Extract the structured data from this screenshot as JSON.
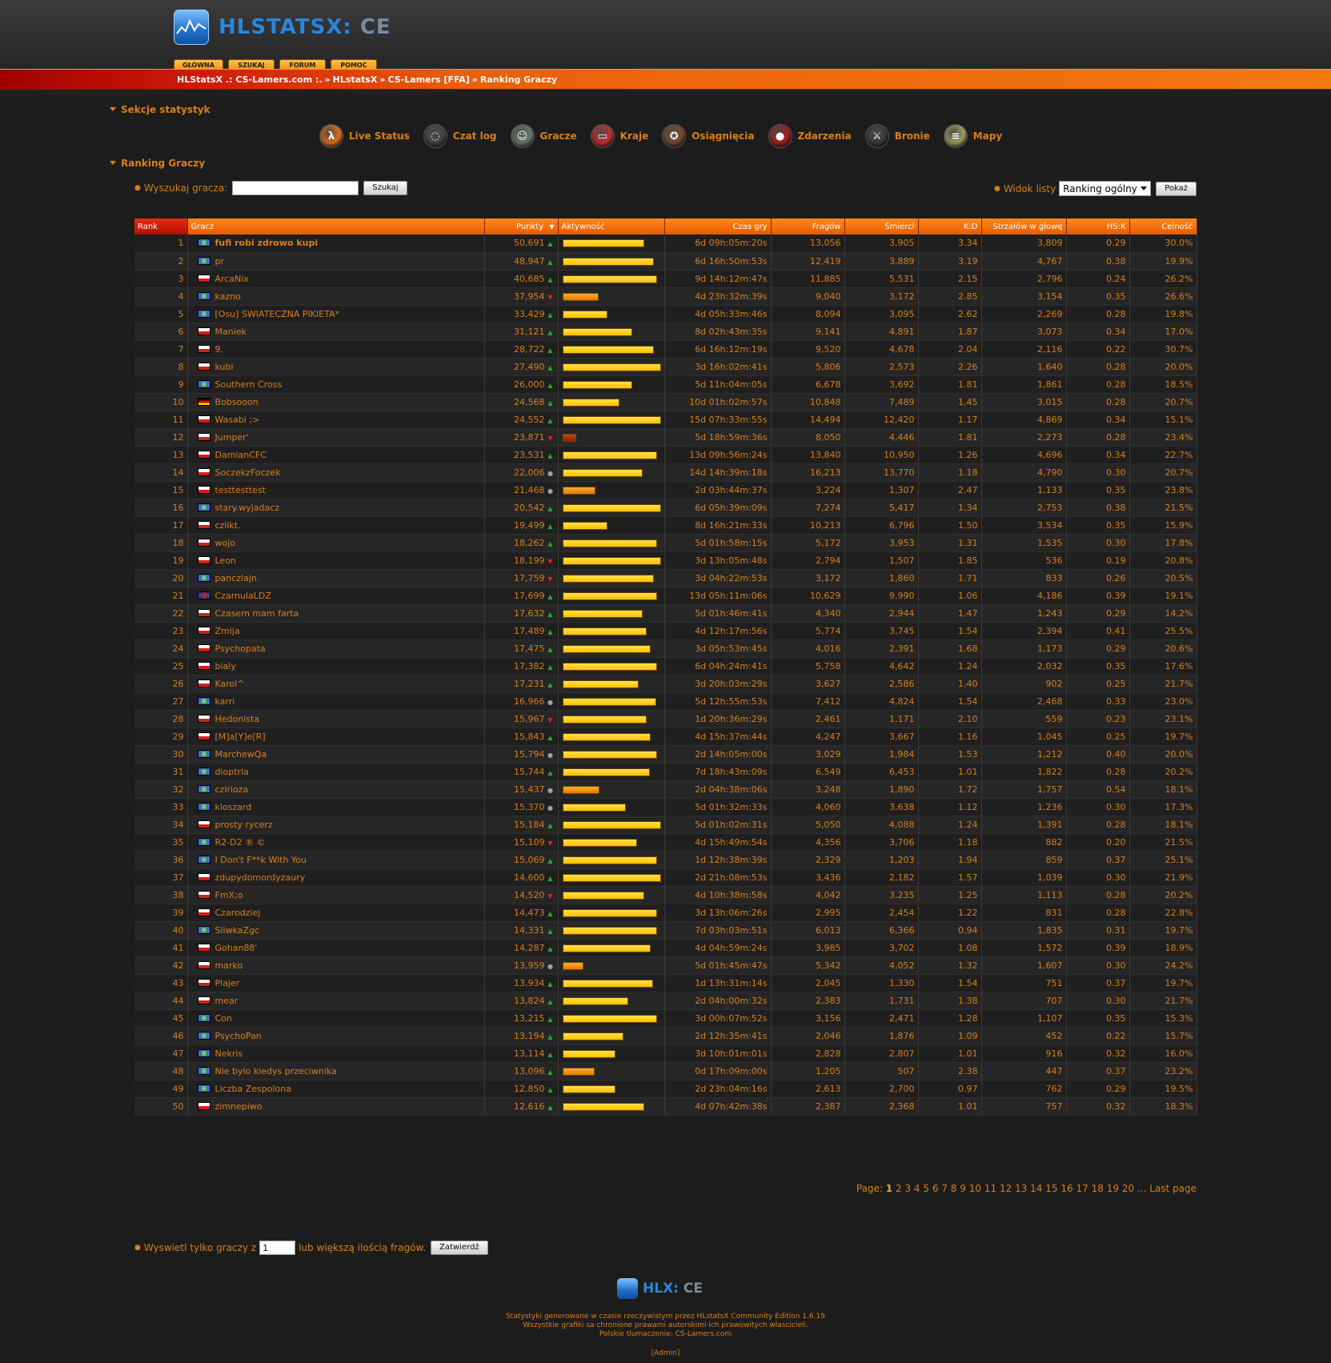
{
  "header": {
    "logo_text": "HLSTATSX:",
    "logo_ce": " CE",
    "nav": [
      "GŁÓWNA",
      "SZUKAJ",
      "FORUM",
      "POMOC"
    ],
    "breadcrumb": [
      "HLStatsX .: CS-Lamers.com :.",
      "HLstatsX",
      "CS-Lamers [FFA]",
      "Ranking Graczy"
    ],
    "breadcrumb_sep": "»"
  },
  "sections": {
    "title": "Sekcje statystyk",
    "items": [
      {
        "label": "Live Status",
        "icon": "half-life-lambda-icon",
        "color": "#e0701a",
        "glyph": "λ"
      },
      {
        "label": "Czat log",
        "icon": "chat-bubble-icon",
        "color": "#444444",
        "glyph": "◌"
      },
      {
        "label": "Gracze",
        "icon": "players-head-icon",
        "color": "#6a7a6a",
        "glyph": "☺"
      },
      {
        "label": "Kraje",
        "icon": "countries-globe-icon",
        "color": "#c23030",
        "glyph": "▭"
      },
      {
        "label": "Osiągnięcia",
        "icon": "achievements-icon",
        "color": "#7a4a2a",
        "glyph": "✪"
      },
      {
        "label": "Zdarzenia",
        "icon": "events-icon",
        "color": "#a02020",
        "glyph": "●"
      },
      {
        "label": "Bronie",
        "icon": "weapons-icon",
        "color": "#3a3a3a",
        "glyph": "⚔"
      },
      {
        "label": "Mapy",
        "icon": "maps-icon",
        "color": "#a0a060",
        "glyph": "≡"
      }
    ]
  },
  "ranking": {
    "title": "Ranking Graczy",
    "search_label": "Wyszukaj gracza:",
    "search_value": "",
    "search_button": "Szukaj",
    "view_label": "Widok listy",
    "view_selected": "Ranking ogólny",
    "view_button": "Pokaż",
    "columns": [
      "Rank",
      "Gracz",
      "Punkty",
      "Aktywność",
      "Czas gry",
      "Fragów",
      "Śmierci",
      "K:D",
      "Strzałów w głowę",
      "HS:K",
      "Celność"
    ],
    "sort_indicator": "▼",
    "rows": [
      {
        "rank": "1",
        "flag": "int",
        "name": "fufi robi zdrowo kupi",
        "points": "50,691",
        "trend": "up",
        "act": 82,
        "time": "6d 09h:05m:20s",
        "frags": "13,056",
        "deaths": "3,905",
        "kd": "3.34",
        "hs": "3,809",
        "hsk": "0.29",
        "acc": "30.0%",
        "bold": true
      },
      {
        "rank": "2",
        "flag": "int",
        "name": "pr",
        "points": "48,947",
        "trend": "up",
        "act": 92,
        "time": "6d 16h:50m:53s",
        "frags": "12,419",
        "deaths": "3,889",
        "kd": "3.19",
        "hs": "4,767",
        "hsk": "0.38",
        "acc": "19.9%"
      },
      {
        "rank": "3",
        "flag": "pl",
        "name": "ArcaNix",
        "points": "40,685",
        "trend": "up",
        "act": 95,
        "time": "9d 14h:12m:47s",
        "frags": "11,885",
        "deaths": "5,531",
        "kd": "2.15",
        "hs": "2,796",
        "hsk": "0.24",
        "acc": "26.2%"
      },
      {
        "rank": "4",
        "flag": "int",
        "name": "kazno",
        "points": "37,954",
        "trend": "down",
        "act": 36,
        "time": "4d 23h:32m:39s",
        "frags": "9,040",
        "deaths": "3,172",
        "kd": "2.85",
        "hs": "3,154",
        "hsk": "0.35",
        "acc": "26.6%"
      },
      {
        "rank": "5",
        "flag": "int",
        "name": "[Osu] SWIATECZNA PIKIETA*",
        "points": "33,429",
        "trend": "up",
        "act": 45,
        "time": "4d 05h:33m:46s",
        "frags": "8,094",
        "deaths": "3,095",
        "kd": "2.62",
        "hs": "2,269",
        "hsk": "0.28",
        "acc": "19.8%"
      },
      {
        "rank": "6",
        "flag": "pl",
        "name": "Maniek",
        "points": "31,121",
        "trend": "up",
        "act": 70,
        "time": "8d 02h:43m:35s",
        "frags": "9,141",
        "deaths": "4,891",
        "kd": "1.87",
        "hs": "3,073",
        "hsk": "0.34",
        "acc": "17.0%"
      },
      {
        "rank": "7",
        "flag": "pl",
        "name": "9.",
        "points": "28,722",
        "trend": "up",
        "act": 92,
        "time": "6d 16h:12m:19s",
        "frags": "9,520",
        "deaths": "4,678",
        "kd": "2.04",
        "hs": "2,116",
        "hsk": "0.22",
        "acc": "30.7%"
      },
      {
        "rank": "8",
        "flag": "pl",
        "name": "kubi",
        "points": "27,490",
        "trend": "up",
        "act": 99,
        "time": "3d 16h:02m:41s",
        "frags": "5,806",
        "deaths": "2,573",
        "kd": "2.26",
        "hs": "1,640",
        "hsk": "0.28",
        "acc": "20.0%"
      },
      {
        "rank": "9",
        "flag": "int",
        "name": "Southern Cross",
        "points": "26,000",
        "trend": "up",
        "act": 70,
        "time": "5d 11h:04m:05s",
        "frags": "6,678",
        "deaths": "3,692",
        "kd": "1.81",
        "hs": "1,861",
        "hsk": "0.28",
        "acc": "18.5%"
      },
      {
        "rank": "10",
        "flag": "de",
        "name": "Bobsooon",
        "points": "24,568",
        "trend": "up",
        "act": 57,
        "time": "10d 01h:02m:57s",
        "frags": "10,848",
        "deaths": "7,489",
        "kd": "1.45",
        "hs": "3,015",
        "hsk": "0.28",
        "acc": "20.7%"
      },
      {
        "rank": "11",
        "flag": "pl",
        "name": "Wasabi ;>",
        "points": "24,552",
        "trend": "up",
        "act": 99,
        "time": "15d 07h:33m:55s",
        "frags": "14,494",
        "deaths": "12,420",
        "kd": "1.17",
        "hs": "4,869",
        "hsk": "0.34",
        "acc": "15.1%"
      },
      {
        "rank": "12",
        "flag": "pl",
        "name": "Jumper'",
        "points": "23,871",
        "trend": "down",
        "act": 14,
        "time": "5d 18h:59m:36s",
        "frags": "8,050",
        "deaths": "4,446",
        "kd": "1.81",
        "hs": "2,273",
        "hsk": "0.28",
        "acc": "23.4%"
      },
      {
        "rank": "13",
        "flag": "pl",
        "name": "DamianCFC",
        "points": "23,531",
        "trend": "up",
        "act": 95,
        "time": "13d 09h:56m:24s",
        "frags": "13,840",
        "deaths": "10,950",
        "kd": "1.26",
        "hs": "4,696",
        "hsk": "0.34",
        "acc": "22.7%"
      },
      {
        "rank": "14",
        "flag": "pl",
        "name": "SoczekzFoczek",
        "points": "22,006",
        "trend": "same",
        "act": 81,
        "time": "14d 14h:39m:18s",
        "frags": "16,213",
        "deaths": "13,770",
        "kd": "1.18",
        "hs": "4,790",
        "hsk": "0.30",
        "acc": "20.7%"
      },
      {
        "rank": "15",
        "flag": "pl",
        "name": "testtesttest",
        "points": "21,468",
        "trend": "same",
        "act": 33,
        "time": "2d 03h:44m:37s",
        "frags": "3,224",
        "deaths": "1,307",
        "kd": "2.47",
        "hs": "1,133",
        "hsk": "0.35",
        "acc": "23.8%"
      },
      {
        "rank": "16",
        "flag": "int",
        "name": "stary.wyjadacz",
        "points": "20,542",
        "trend": "up",
        "act": 99,
        "time": "6d 05h:39m:09s",
        "frags": "7,274",
        "deaths": "5,417",
        "kd": "1.34",
        "hs": "2,753",
        "hsk": "0.38",
        "acc": "21.5%"
      },
      {
        "rank": "17",
        "flag": "pl",
        "name": "czlikt.",
        "points": "19,499",
        "trend": "up",
        "act": 45,
        "time": "8d 16h:21m:33s",
        "frags": "10,213",
        "deaths": "6,796",
        "kd": "1.50",
        "hs": "3,534",
        "hsk": "0.35",
        "acc": "15.9%"
      },
      {
        "rank": "18",
        "flag": "pl",
        "name": "wojo",
        "points": "18,262",
        "trend": "up",
        "act": 95,
        "time": "5d 01h:58m:15s",
        "frags": "5,172",
        "deaths": "3,953",
        "kd": "1.31",
        "hs": "1,535",
        "hsk": "0.30",
        "acc": "17.8%"
      },
      {
        "rank": "19",
        "flag": "pl",
        "name": "Leon",
        "points": "18,199",
        "trend": "down",
        "act": 99,
        "time": "3d 13h:05m:48s",
        "frags": "2,794",
        "deaths": "1,507",
        "kd": "1.85",
        "hs": "536",
        "hsk": "0.19",
        "acc": "20.8%"
      },
      {
        "rank": "20",
        "flag": "int",
        "name": "panczlajn.",
        "points": "17,759",
        "trend": "down",
        "act": 92,
        "time": "3d 04h:22m:53s",
        "frags": "3,172",
        "deaths": "1,860",
        "kd": "1.71",
        "hs": "833",
        "hsk": "0.26",
        "acc": "20.5%"
      },
      {
        "rank": "21",
        "flag": "uk",
        "name": "CzarnulaLDZ",
        "points": "17,699",
        "trend": "up",
        "act": 95,
        "time": "13d 05h:11m:06s",
        "frags": "10,629",
        "deaths": "9,990",
        "kd": "1.06",
        "hs": "4,186",
        "hsk": "0.39",
        "acc": "19.1%"
      },
      {
        "rank": "22",
        "flag": "pl",
        "name": "Czasem mam farta",
        "points": "17,632",
        "trend": "up",
        "act": 81,
        "time": "5d 01h:46m:41s",
        "frags": "4,340",
        "deaths": "2,944",
        "kd": "1.47",
        "hs": "1,243",
        "hsk": "0.29",
        "acc": "14.2%"
      },
      {
        "rank": "23",
        "flag": "pl",
        "name": "Zmija",
        "points": "17,489",
        "trend": "up",
        "act": 85,
        "time": "4d 12h:17m:56s",
        "frags": "5,774",
        "deaths": "3,745",
        "kd": "1.54",
        "hs": "2,394",
        "hsk": "0.41",
        "acc": "25.5%"
      },
      {
        "rank": "24",
        "flag": "pl",
        "name": "Psychopata",
        "points": "17,475",
        "trend": "up",
        "act": 89,
        "time": "3d 05h:53m:45s",
        "frags": "4,016",
        "deaths": "2,391",
        "kd": "1.68",
        "hs": "1,173",
        "hsk": "0.29",
        "acc": "20.6%"
      },
      {
        "rank": "25",
        "flag": "pl",
        "name": "bialy",
        "points": "17,382",
        "trend": "up",
        "act": 95,
        "time": "6d 04h:24m:41s",
        "frags": "5,758",
        "deaths": "4,642",
        "kd": "1.24",
        "hs": "2,032",
        "hsk": "0.35",
        "acc": "17.6%"
      },
      {
        "rank": "26",
        "flag": "pl",
        "name": "Karol^",
        "points": "17,231",
        "trend": "up",
        "act": 77,
        "time": "3d 20h:03m:29s",
        "frags": "3,627",
        "deaths": "2,586",
        "kd": "1.40",
        "hs": "902",
        "hsk": "0.25",
        "acc": "21.7%"
      },
      {
        "rank": "27",
        "flag": "int",
        "name": "karri",
        "points": "16,966",
        "trend": "same",
        "act": 94,
        "time": "5d 12h:55m:53s",
        "frags": "7,412",
        "deaths": "4,824",
        "kd": "1.54",
        "hs": "2,468",
        "hsk": "0.33",
        "acc": "23.0%"
      },
      {
        "rank": "28",
        "flag": "pl",
        "name": "Hedonista",
        "points": "15,967",
        "trend": "down",
        "act": 85,
        "time": "1d 20h:36m:29s",
        "frags": "2,461",
        "deaths": "1,171",
        "kd": "2.10",
        "hs": "559",
        "hsk": "0.23",
        "acc": "23.1%"
      },
      {
        "rank": "29",
        "flag": "pl",
        "name": "[M]a[Y]e[R]",
        "points": "15,843",
        "trend": "up",
        "act": 89,
        "time": "4d 15h:37m:44s",
        "frags": "4,247",
        "deaths": "3,667",
        "kd": "1.16",
        "hs": "1,045",
        "hsk": "0.25",
        "acc": "19.7%"
      },
      {
        "rank": "30",
        "flag": "int",
        "name": "MarchewQa",
        "points": "15,794",
        "trend": "same",
        "act": 95,
        "time": "2d 14h:05m:00s",
        "frags": "3,029",
        "deaths": "1,984",
        "kd": "1.53",
        "hs": "1,212",
        "hsk": "0.40",
        "acc": "20.0%"
      },
      {
        "rank": "31",
        "flag": "int",
        "name": "dioptria",
        "points": "15,744",
        "trend": "up",
        "act": 88,
        "time": "7d 18h:43m:09s",
        "frags": "6,549",
        "deaths": "6,453",
        "kd": "1.01",
        "hs": "1,822",
        "hsk": "0.28",
        "acc": "20.2%"
      },
      {
        "rank": "32",
        "flag": "int",
        "name": "czirioza",
        "points": "15,437",
        "trend": "same",
        "act": 37,
        "time": "2d 04h:38m:06s",
        "frags": "3,248",
        "deaths": "1,890",
        "kd": "1.72",
        "hs": "1,757",
        "hsk": "0.54",
        "acc": "18.1%"
      },
      {
        "rank": "33",
        "flag": "int",
        "name": "kloszard",
        "points": "15,370",
        "trend": "same",
        "act": 64,
        "time": "5d 01h:32m:33s",
        "frags": "4,060",
        "deaths": "3,638",
        "kd": "1.12",
        "hs": "1,236",
        "hsk": "0.30",
        "acc": "17.3%"
      },
      {
        "rank": "34",
        "flag": "pl",
        "name": "prosty rycerz",
        "points": "15,184",
        "trend": "up",
        "act": 99,
        "time": "5d 01h:02m:31s",
        "frags": "5,050",
        "deaths": "4,088",
        "kd": "1.24",
        "hs": "1,391",
        "hsk": "0.28",
        "acc": "18.1%"
      },
      {
        "rank": "35",
        "flag": "int",
        "name": "R2-D2 ® ©",
        "points": "15,109",
        "trend": "down",
        "act": 75,
        "time": "4d 15h:49m:54s",
        "frags": "4,356",
        "deaths": "3,706",
        "kd": "1.18",
        "hs": "882",
        "hsk": "0.20",
        "acc": "21.5%"
      },
      {
        "rank": "36",
        "flag": "int",
        "name": "I Don't F**k With You",
        "points": "15,069",
        "trend": "up",
        "act": 95,
        "time": "1d 12h:38m:39s",
        "frags": "2,329",
        "deaths": "1,203",
        "kd": "1.94",
        "hs": "859",
        "hsk": "0.37",
        "acc": "25.1%"
      },
      {
        "rank": "37",
        "flag": "pl",
        "name": "zdupydomordyzaury",
        "points": "14,600",
        "trend": "up",
        "act": 99,
        "time": "2d 21h:08m:53s",
        "frags": "3,436",
        "deaths": "2,182",
        "kd": "1.57",
        "hs": "1,039",
        "hsk": "0.30",
        "acc": "21.9%"
      },
      {
        "rank": "38",
        "flag": "pl",
        "name": "FmX;o",
        "points": "14,520",
        "trend": "down",
        "act": 82,
        "time": "4d 10h:38m:58s",
        "frags": "4,042",
        "deaths": "3,235",
        "kd": "1.25",
        "hs": "1,113",
        "hsk": "0.28",
        "acc": "20.2%"
      },
      {
        "rank": "39",
        "flag": "pl",
        "name": "Czarodziej",
        "points": "14,473",
        "trend": "up",
        "act": 95,
        "time": "3d 13h:06m:26s",
        "frags": "2,995",
        "deaths": "2,454",
        "kd": "1.22",
        "hs": "831",
        "hsk": "0.28",
        "acc": "22.8%"
      },
      {
        "rank": "40",
        "flag": "int",
        "name": "SliwkaZgc",
        "points": "14,331",
        "trend": "up",
        "act": 95,
        "time": "7d 03h:03m:51s",
        "frags": "6,013",
        "deaths": "6,366",
        "kd": "0.94",
        "hs": "1,835",
        "hsk": "0.31",
        "acc": "19.7%"
      },
      {
        "rank": "41",
        "flag": "pl",
        "name": "Gohan88'",
        "points": "14,287",
        "trend": "up",
        "act": 89,
        "time": "4d 04h:59m:24s",
        "frags": "3,985",
        "deaths": "3,702",
        "kd": "1.08",
        "hs": "1,572",
        "hsk": "0.39",
        "acc": "18.9%"
      },
      {
        "rank": "42",
        "flag": "pl",
        "name": "marko",
        "points": "13,959",
        "trend": "same",
        "act": 21,
        "time": "5d 01h:45m:47s",
        "frags": "5,342",
        "deaths": "4,052",
        "kd": "1.32",
        "hs": "1,607",
        "hsk": "0.30",
        "acc": "24.2%"
      },
      {
        "rank": "43",
        "flag": "pl",
        "name": "Plajer",
        "points": "13,934",
        "trend": "up",
        "act": 91,
        "time": "1d 13h:31m:14s",
        "frags": "2,045",
        "deaths": "1,330",
        "kd": "1.54",
        "hs": "751",
        "hsk": "0.37",
        "acc": "19.7%"
      },
      {
        "rank": "44",
        "flag": "pl",
        "name": "mear",
        "points": "13,824",
        "trend": "up",
        "act": 66,
        "time": "2d 04h:00m:32s",
        "frags": "2,383",
        "deaths": "1,731",
        "kd": "1.38",
        "hs": "707",
        "hsk": "0.30",
        "acc": "21.7%"
      },
      {
        "rank": "45",
        "flag": "int",
        "name": "Con",
        "points": "13,215",
        "trend": "up",
        "act": 95,
        "time": "3d 00h:07m:52s",
        "frags": "3,156",
        "deaths": "2,471",
        "kd": "1.28",
        "hs": "1,107",
        "hsk": "0.35",
        "acc": "15.3%"
      },
      {
        "rank": "46",
        "flag": "int",
        "name": "PsychoPan",
        "points": "13,194",
        "trend": "up",
        "act": 61,
        "time": "2d 12h:35m:41s",
        "frags": "2,046",
        "deaths": "1,876",
        "kd": "1.09",
        "hs": "452",
        "hsk": "0.22",
        "acc": "15.7%"
      },
      {
        "rank": "47",
        "flag": "int",
        "name": "Nekris",
        "points": "13,114",
        "trend": "up",
        "act": 53,
        "time": "3d 10h:01m:01s",
        "frags": "2,828",
        "deaths": "2,807",
        "kd": "1.01",
        "hs": "916",
        "hsk": "0.32",
        "acc": "16.0%"
      },
      {
        "rank": "48",
        "flag": "int",
        "name": "Nie bylo kiedys przeciwnika",
        "points": "13,096",
        "trend": "up",
        "act": 32,
        "time": "0d 17h:09m:00s",
        "frags": "1,205",
        "deaths": "507",
        "kd": "2.38",
        "hs": "447",
        "hsk": "0.37",
        "acc": "23.2%"
      },
      {
        "rank": "49",
        "flag": "int",
        "name": "Liczba Zespolona",
        "points": "12,850",
        "trend": "up",
        "act": 53,
        "time": "2d 23h:04m:16s",
        "frags": "2,613",
        "deaths": "2,700",
        "kd": "0.97",
        "hs": "762",
        "hsk": "0.29",
        "acc": "19.5%"
      },
      {
        "rank": "50",
        "flag": "pl",
        "name": "zimnepiwo",
        "points": "12,616",
        "trend": "up",
        "act": 82,
        "time": "4d 07h:42m:38s",
        "frags": "2,387",
        "deaths": "2,368",
        "kd": "1.01",
        "hs": "757",
        "hsk": "0.32",
        "acc": "18.3%"
      }
    ]
  },
  "pagination": {
    "label": "Page:",
    "current": "1",
    "pages": [
      "2",
      "3",
      "4",
      "5",
      "6",
      "7",
      "8",
      "9",
      "10",
      "11",
      "12",
      "13",
      "14",
      "15",
      "16",
      "17",
      "18",
      "19",
      "20"
    ],
    "ellipsis": "...",
    "last": "Last page"
  },
  "filter": {
    "label_before": "Wyswietl tylko graczy z",
    "value": "1",
    "label_after": "lub większą ilością fragów.",
    "button": "Zatwierdź"
  },
  "footer": {
    "logo_text": "HLX:",
    "logo_ce": " CE",
    "line1": "Statystyki generowane w czasie rzeczywistym przez HLstatsX Community Edition 1.6.19",
    "line2": "Wszystkie grafiki sa chronione prawami autorskimi ich prawowitych wlascicieli.",
    "line3": "Polskie tlumaczenie: CS-Lamers.com",
    "admin": "[Admin]"
  }
}
